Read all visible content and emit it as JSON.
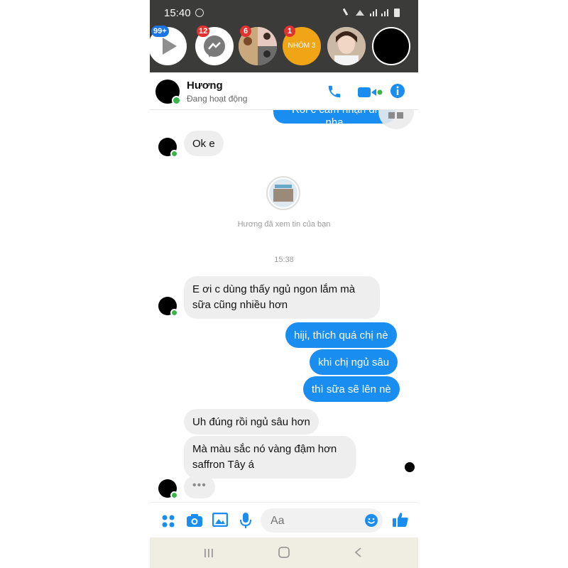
{
  "status_bar": {
    "time": "15:40"
  },
  "chat_heads": [
    {
      "badge": "99+",
      "icon": "play-icon"
    },
    {
      "badge": "12",
      "icon": "messenger-icon"
    },
    {
      "badge": "6"
    },
    {
      "badge": "1",
      "group_label": "NHÓM 3"
    },
    {},
    {}
  ],
  "header": {
    "contact_name": "Hương",
    "status": "Đang hoạt động"
  },
  "conversation": {
    "partial_bubble_text": "Rồi c cảm nhận di nha",
    "messages_1": [
      {
        "text": "Ok e"
      }
    ],
    "story_reply": "Hương đã xem tin của bạn",
    "timestamp": "15:38",
    "incoming_1": {
      "text": "E ơi c dùng thấy ngủ ngon lắm mà sữa cũng nhiều hơn"
    },
    "outgoing": [
      {
        "text": "hiji, thích quá chị nè"
      },
      {
        "text": "khi chị ngủ sâu"
      },
      {
        "text": "thì sữa sẽ lên nè"
      }
    ],
    "incoming_2": [
      {
        "text": "Uh đúng rồi ngủ sâu hơn"
      },
      {
        "text": "Mà màu sắc nó vàng đậm hơn saffron Tây á"
      }
    ],
    "typing": "•••"
  },
  "composer": {
    "placeholder": "Aa"
  },
  "colors": {
    "accent": "#1a8df1",
    "online": "#3ab54a",
    "badge": "#e0322f"
  }
}
